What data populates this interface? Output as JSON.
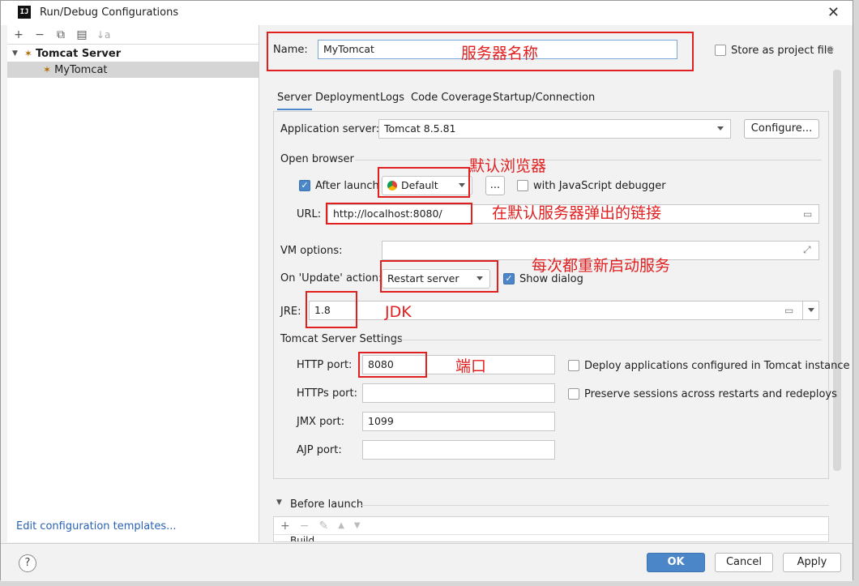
{
  "window": {
    "title": "Run/Debug Configurations",
    "app_icon_label": "IJ"
  },
  "left_panel": {
    "toolbar": [
      "+",
      "−",
      "⧉",
      "▤",
      "↓a"
    ],
    "tree": {
      "group_label": "Tomcat Server",
      "child_label": "MyTomcat"
    },
    "edit_templates_link": "Edit configuration templates..."
  },
  "config": {
    "name_label": "Name:",
    "name_value": "MyTomcat",
    "store_label": "Store as project file",
    "tabs": [
      "Server",
      "Deployment",
      "Logs",
      "Code Coverage",
      "Startup/Connection"
    ],
    "app_server_label": "Application server:",
    "app_server_value": "Tomcat 8.5.81",
    "configure_button": "Configure...",
    "open_browser_section": "Open browser",
    "after_launch_label": "After launch",
    "browser_value": "Default",
    "browse_button": "...",
    "js_debugger_label": "with JavaScript debugger",
    "url_label": "URL:",
    "url_value": "http://localhost:8080/",
    "vm_options_label": "VM options:",
    "update_action_label": "On 'Update' action:",
    "update_action_value": "Restart server",
    "show_dialog_label": "Show dialog",
    "jre_label": "JRE:",
    "jre_value": "1.8",
    "tomcat_settings_section": "Tomcat Server Settings",
    "http_port_label": "HTTP port:",
    "http_port_value": "8080",
    "https_port_label": "HTTPs port:",
    "https_port_value": "",
    "jmx_port_label": "JMX port:",
    "jmx_port_value": "1099",
    "ajp_port_label": "AJP port:",
    "ajp_port_value": "",
    "deploy_configured_label": "Deploy applications configured in Tomcat instance",
    "preserve_sessions_label": "Preserve sessions across restarts and redeploys",
    "before_launch_label": "Before launch",
    "before_launch_partial": "Build"
  },
  "annotations": {
    "server_name": "服务器名称",
    "default_browser": "默认浏览器",
    "default_link": "在默认服务器弹出的链接",
    "restart_each": "每次都重新启动服务",
    "jdk": "JDK",
    "port": "端口"
  },
  "buttons": {
    "ok": "OK",
    "cancel": "Cancel",
    "apply": "Apply",
    "help": "?"
  },
  "colors": {
    "accent": "#4a86c8",
    "annotation_red": "#e02020"
  }
}
